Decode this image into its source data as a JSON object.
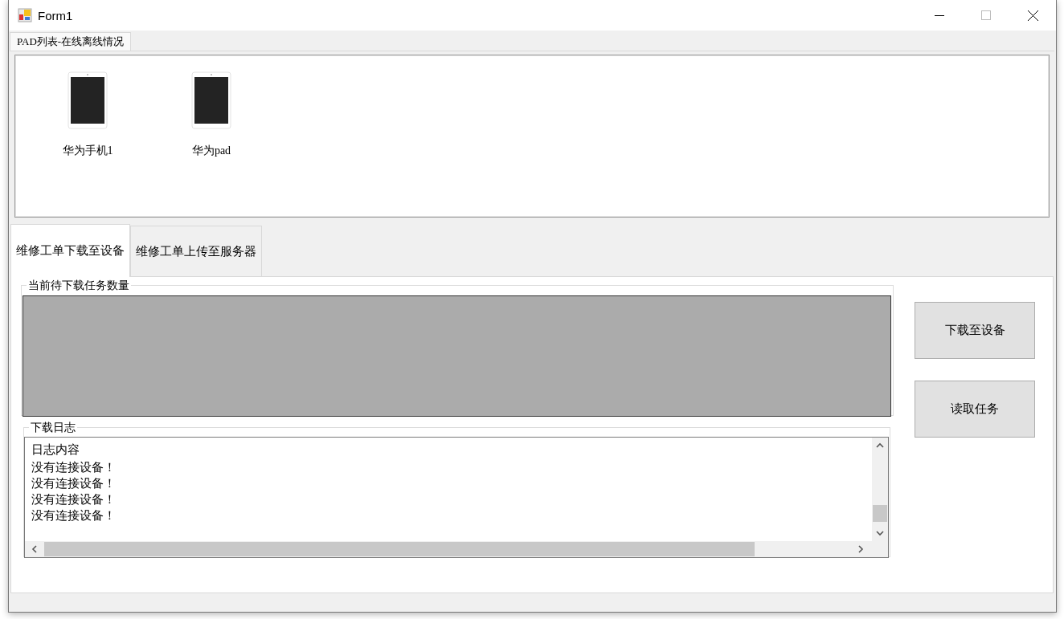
{
  "window": {
    "title": "Form1"
  },
  "top_tabs": [
    {
      "label": "PAD列表-在线离线情况",
      "selected": true
    }
  ],
  "devices": [
    {
      "name": "华为手机1"
    },
    {
      "name": "华为pad"
    }
  ],
  "tabs": [
    {
      "label": "维修工单下载至设备",
      "selected": true
    },
    {
      "label": "维修工单上传至服务器",
      "selected": false
    }
  ],
  "task_group": {
    "title": "当前待下载任务数量"
  },
  "log_group": {
    "title": "下载日志",
    "lines": [
      "日志内容",
      "没有连接设备！",
      "没有连接设备！",
      "没有连接设备！",
      "没有连接设备！"
    ]
  },
  "buttons": [
    "下载至设备",
    "读取任务"
  ]
}
